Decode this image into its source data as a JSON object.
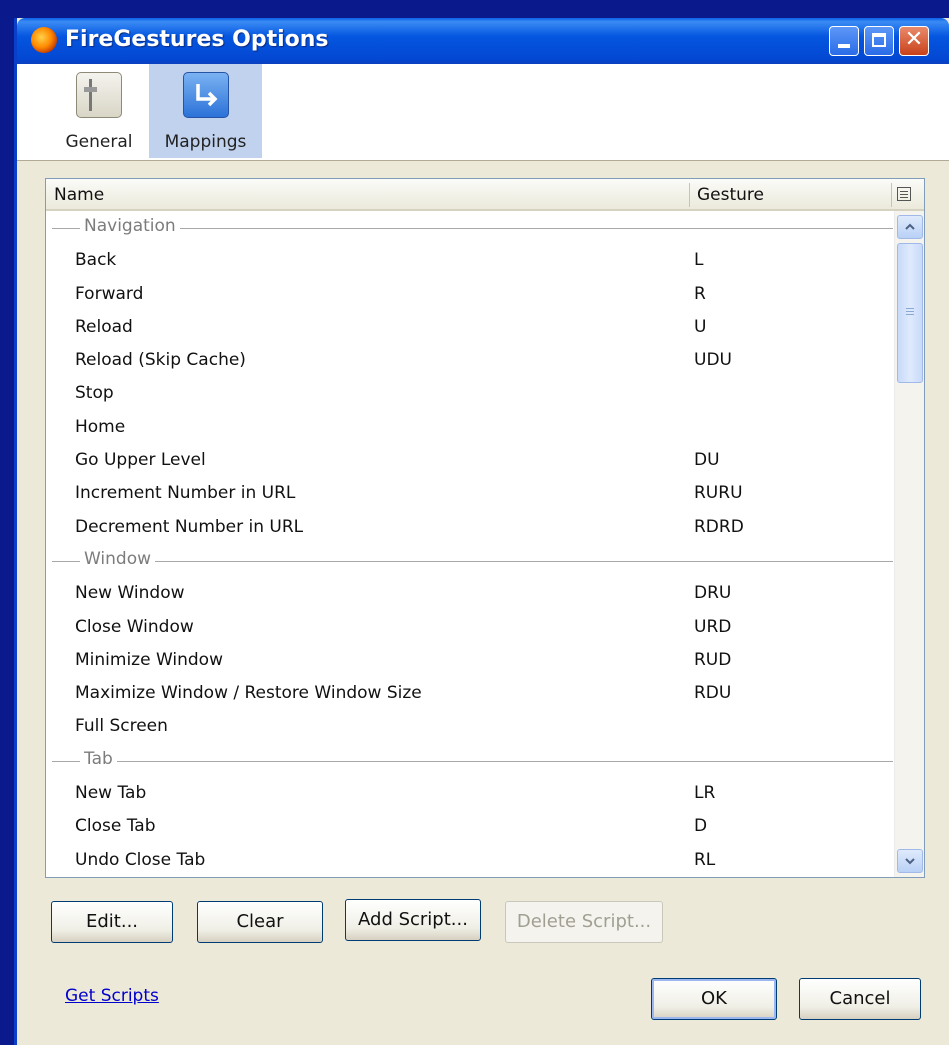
{
  "window": {
    "title": "FireGestures Options",
    "controls": {
      "minimize_icon": "minimize-icon",
      "maximize_icon": "maximize-icon",
      "close_icon": "close-icon"
    }
  },
  "toolbar": {
    "items": [
      {
        "label": "General",
        "icon": "general-icon",
        "selected": false
      },
      {
        "label": "Mappings",
        "icon": "mappings-icon",
        "selected": true
      }
    ]
  },
  "list": {
    "columns": {
      "name": "Name",
      "gesture": "Gesture"
    },
    "groups": [
      {
        "label": "Navigation",
        "items": [
          {
            "name": "Back",
            "gesture": "L"
          },
          {
            "name": "Forward",
            "gesture": "R"
          },
          {
            "name": "Reload",
            "gesture": "U"
          },
          {
            "name": "Reload (Skip Cache)",
            "gesture": "UDU"
          },
          {
            "name": "Stop",
            "gesture": ""
          },
          {
            "name": "Home",
            "gesture": ""
          },
          {
            "name": "Go Upper Level",
            "gesture": "DU"
          },
          {
            "name": "Increment Number in URL",
            "gesture": "RURU"
          },
          {
            "name": "Decrement Number in URL",
            "gesture": "RDRD"
          }
        ]
      },
      {
        "label": "Window",
        "items": [
          {
            "name": "New Window",
            "gesture": "DRU"
          },
          {
            "name": "Close Window",
            "gesture": "URD"
          },
          {
            "name": "Minimize Window",
            "gesture": "RUD"
          },
          {
            "name": "Maximize Window / Restore Window Size",
            "gesture": "RDU"
          },
          {
            "name": "Full Screen",
            "gesture": ""
          }
        ]
      },
      {
        "label": "Tab",
        "items": [
          {
            "name": "New Tab",
            "gesture": "LR"
          },
          {
            "name": "Close Tab",
            "gesture": "D"
          },
          {
            "name": "Undo Close Tab",
            "gesture": "RL"
          }
        ]
      }
    ]
  },
  "buttons": {
    "edit": "Edit...",
    "clear": "Clear",
    "add_script": "Add Script...",
    "delete_script": "Delete Script...",
    "ok": "OK",
    "cancel": "Cancel"
  },
  "links": {
    "get_scripts": "Get Scripts"
  },
  "colors": {
    "titlebar": "#0556e0",
    "dialog_bg": "#ece9d8",
    "selected_tab": "#c1d2ee",
    "link": "#0000cc"
  }
}
